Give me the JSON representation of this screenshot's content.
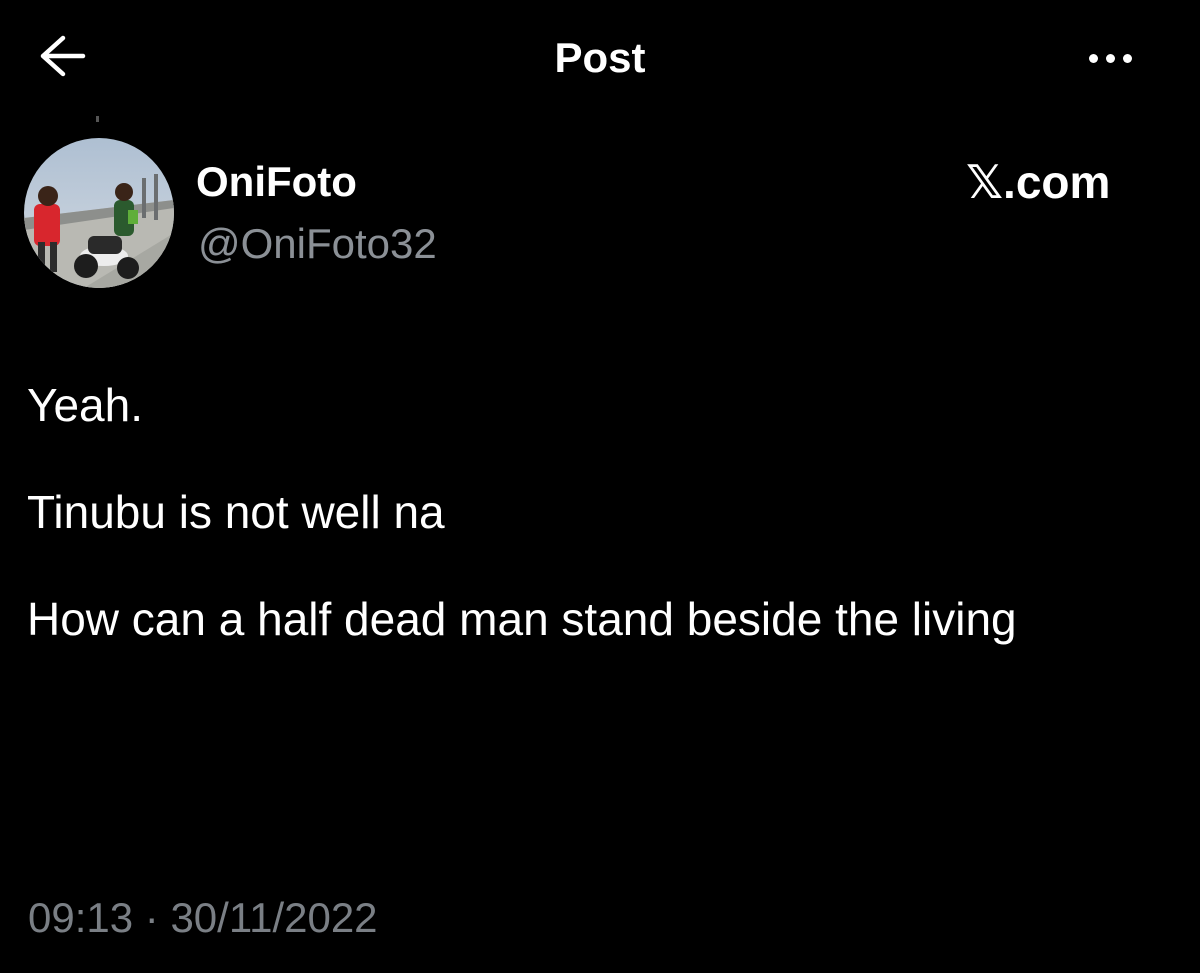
{
  "header": {
    "title": "Post",
    "back_icon": "arrow-left-icon",
    "more_icon": "more-horizontal-icon"
  },
  "author": {
    "name": "OniFoto",
    "handle": "@OniFoto32"
  },
  "watermark": "𝕏.com",
  "post": {
    "paragraphs": [
      "Yeah.",
      "Tinubu is not well na",
      "How can a half dead man stand beside the living"
    ]
  },
  "meta": {
    "time": "09:13",
    "separator": "·",
    "date": "30/11/2022"
  },
  "colors": {
    "background": "#000000",
    "text_primary": "#ffffff",
    "text_secondary": "#8b9096"
  }
}
